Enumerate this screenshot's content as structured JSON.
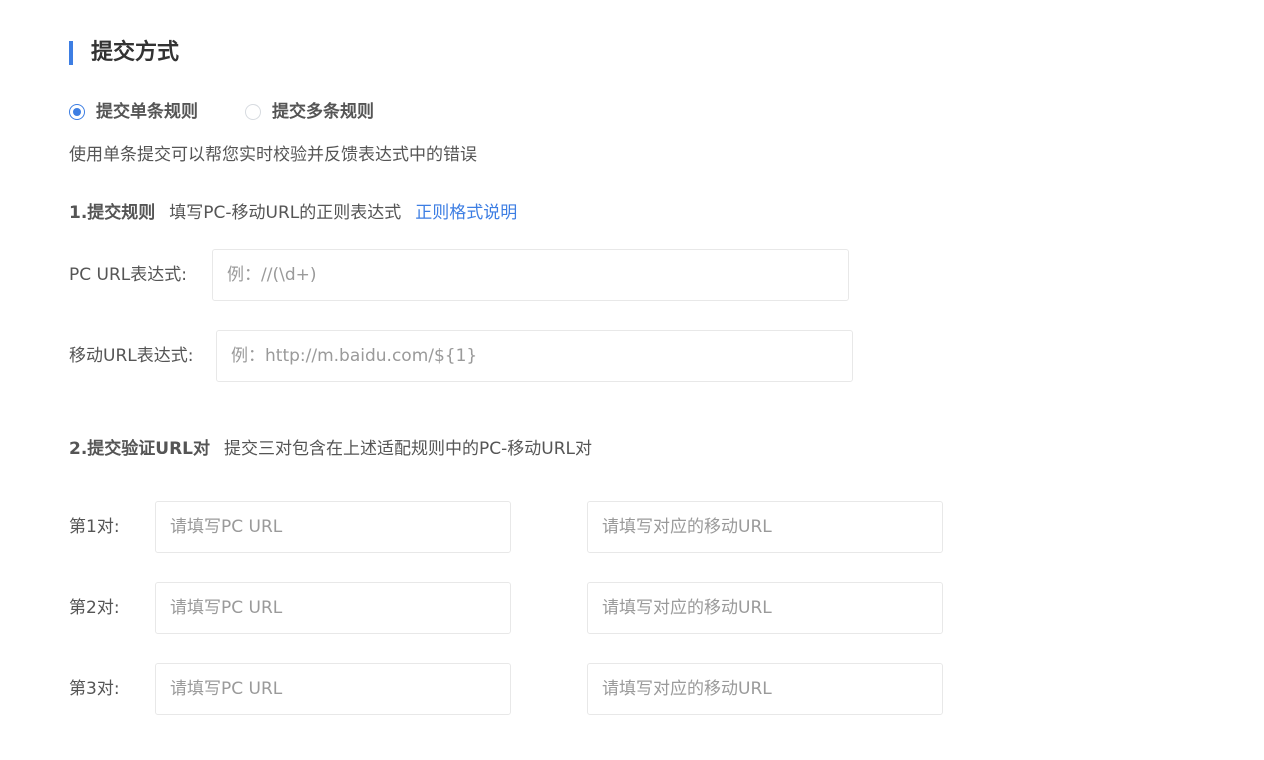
{
  "section": {
    "title": "提交方式"
  },
  "submit_mode": {
    "options": [
      {
        "label": "提交单条规则",
        "checked": true
      },
      {
        "label": "提交多条规则",
        "checked": false
      }
    ],
    "description": "使用单条提交可以帮您实时校验并反馈表达式中的错误"
  },
  "step1": {
    "title": "1.提交规则",
    "text": "填写PC-移动URL的正则表达式",
    "link": "正则格式说明",
    "pc_label": "PC  URL表达式:",
    "pc_placeholder": "例：//(\\d+)",
    "mobile_label": "移动URL表达式:",
    "mobile_placeholder": "例：http://m.baidu.com/${1}"
  },
  "step2": {
    "title": "2.提交验证URL对",
    "text": "提交三对包含在上述适配规则中的PC-移动URL对",
    "pairs": [
      {
        "label": "第1对:",
        "pc_placeholder": "请填写PC URL",
        "mobile_placeholder": "请填写对应的移动URL"
      },
      {
        "label": "第2对:",
        "pc_placeholder": "请填写PC URL",
        "mobile_placeholder": "请填写对应的移动URL"
      },
      {
        "label": "第3对:",
        "pc_placeholder": "请填写PC URL",
        "mobile_placeholder": "请填写对应的移动URL"
      }
    ]
  },
  "colors": {
    "accent": "#3d7ee3",
    "text": "#555555",
    "title": "#333333",
    "placeholder": "#9a9a9a",
    "border": "#e8e8e8"
  }
}
